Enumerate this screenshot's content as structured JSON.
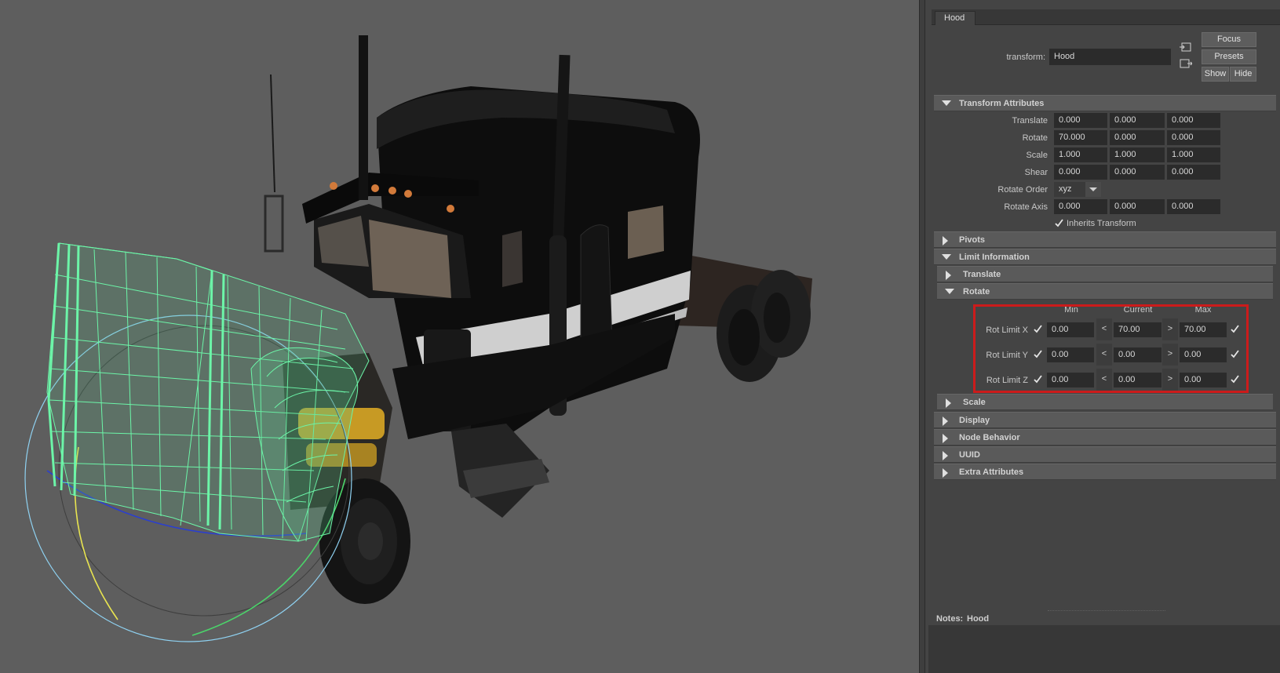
{
  "tab": {
    "label": "Hood"
  },
  "node": {
    "type_label": "transform:",
    "name": "Hood"
  },
  "buttons": {
    "focus": "Focus",
    "presets": "Presets",
    "show": "Show",
    "hide": "Hide"
  },
  "transform_attributes": {
    "title": "Transform Attributes",
    "rows": [
      {
        "label": "Translate",
        "values": [
          "0.000",
          "0.000",
          "0.000"
        ]
      },
      {
        "label": "Rotate",
        "values": [
          "70.000",
          "0.000",
          "0.000"
        ]
      },
      {
        "label": "Scale",
        "values": [
          "1.000",
          "1.000",
          "1.000"
        ]
      },
      {
        "label": "Shear",
        "values": [
          "0.000",
          "0.000",
          "0.000"
        ]
      }
    ],
    "rotate_order": {
      "label": "Rotate Order",
      "value": "xyz"
    },
    "rotate_axis": {
      "label": "Rotate Axis",
      "values": [
        "0.000",
        "0.000",
        "0.000"
      ]
    },
    "inherits": {
      "label": "Inherits Transform",
      "checked": true
    }
  },
  "pivots": {
    "title": "Pivots"
  },
  "limit_information": {
    "title": "Limit Information",
    "translate": {
      "title": "Translate"
    },
    "rotate": {
      "title": "Rotate",
      "headers": {
        "min": "Min",
        "current": "Current",
        "max": "Max"
      },
      "rows": [
        {
          "label": "Rot Limit X",
          "min": "0.00",
          "current": "70.00",
          "max": "70.00",
          "min_on": true,
          "max_on": true
        },
        {
          "label": "Rot Limit Y",
          "min": "0.00",
          "current": "0.00",
          "max": "0.00",
          "min_on": true,
          "max_on": true
        },
        {
          "label": "Rot Limit Z",
          "min": "0.00",
          "current": "0.00",
          "max": "0.00",
          "min_on": true,
          "max_on": true
        }
      ],
      "lt": "<",
      "gt": ">"
    },
    "scale": {
      "title": "Scale"
    }
  },
  "frames": {
    "display": "Display",
    "node_behavior": "Node Behavior",
    "uuid": "UUID",
    "extra": "Extra Attributes"
  },
  "notes": {
    "label": "Notes:",
    "value": "Hood"
  },
  "colors": {
    "highlight": "#cc1b1b",
    "wireframe": "#6cf5a8",
    "viewport_bg": "#5e5e5e"
  }
}
